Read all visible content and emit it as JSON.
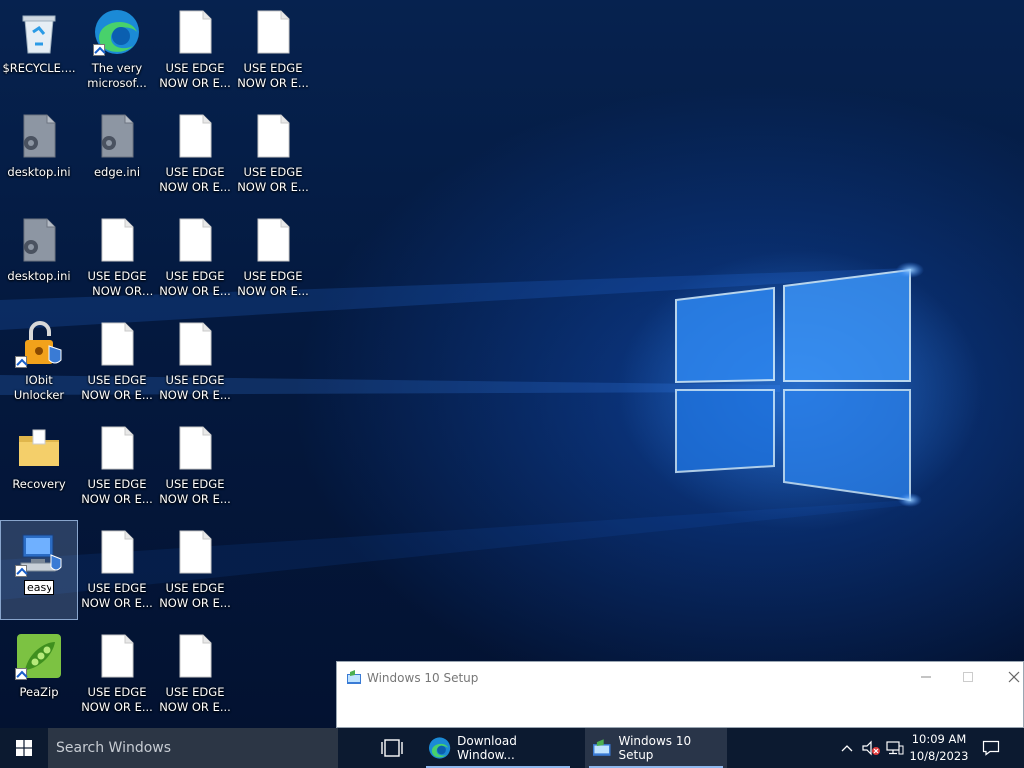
{
  "desktop_icons": [
    {
      "label": "$RECYCLE....",
      "kind": "recycle-bin"
    },
    {
      "label": "The very microsof...",
      "kind": "edge-shortcut"
    },
    {
      "label": "USE EDGE NOW OR E...",
      "kind": "blank-file"
    },
    {
      "label": "USE EDGE NOW OR E...",
      "kind": "blank-file"
    },
    {
      "label": "desktop.ini",
      "kind": "settings-file"
    },
    {
      "label": "edge.ini",
      "kind": "settings-file"
    },
    {
      "label": "USE EDGE NOW OR E...",
      "kind": "blank-file"
    },
    {
      "label": "USE EDGE NOW OR E...",
      "kind": "blank-file"
    },
    {
      "label": "desktop.ini",
      "kind": "settings-file"
    },
    {
      "label": "USE EDGE NOW OR EL...",
      "kind": "blank-file"
    },
    {
      "label": "USE EDGE NOW OR E...",
      "kind": "blank-file"
    },
    {
      "label": "USE EDGE NOW OR E...",
      "kind": "blank-file"
    },
    {
      "label": "IObit Unlocker",
      "kind": "iobit-unlocker-shortcut"
    },
    {
      "label": "USE EDGE NOW OR E...",
      "kind": "blank-file"
    },
    {
      "label": "USE EDGE NOW OR E...",
      "kind": "blank-file"
    },
    {
      "label": "Recovery",
      "kind": "folder"
    },
    {
      "label": "USE EDGE NOW OR E...",
      "kind": "blank-file"
    },
    {
      "label": "USE EDGE NOW OR E...",
      "kind": "blank-file"
    },
    {
      "label": "easy",
      "kind": "easybcd-shortcut",
      "renaming": true
    },
    {
      "label": "USE EDGE NOW OR E...",
      "kind": "blank-file"
    },
    {
      "label": "USE EDGE NOW OR E...",
      "kind": "blank-file"
    },
    {
      "label": "PeaZip",
      "kind": "peazip-shortcut"
    },
    {
      "label": "USE EDGE NOW OR E...",
      "kind": "blank-file"
    },
    {
      "label": "USE EDGE NOW OR E...",
      "kind": "blank-file"
    }
  ],
  "setup_window": {
    "title": "Windows 10 Setup",
    "icon": "setup-icon",
    "controls": [
      "minimize",
      "maximize",
      "close"
    ]
  },
  "taskbar": {
    "search_placeholder": "Search Windows",
    "apps": [
      {
        "label": "Download Window...",
        "icon": "edge-icon"
      },
      {
        "label": "Windows 10 Setup",
        "icon": "setup-icon"
      }
    ],
    "tray": {
      "time": "10:09 AM",
      "date": "10/8/2023"
    }
  },
  "colors": {
    "taskbar": "#0c1a30",
    "search_box": "#2c3645",
    "accent": "#8fb8ee",
    "wallpaper": "#04193f"
  }
}
